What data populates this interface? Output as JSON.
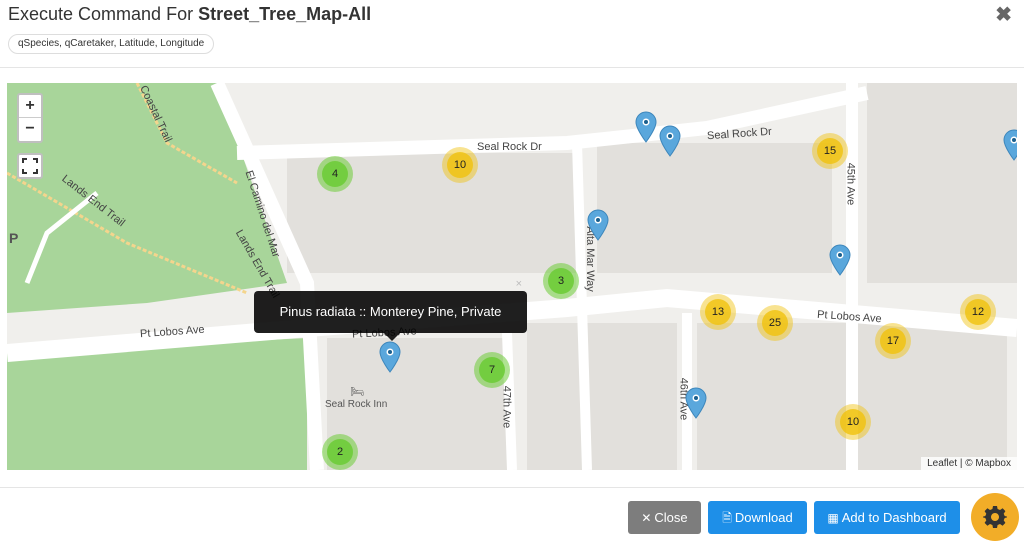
{
  "header": {
    "title_prefix": "Execute Command For ",
    "title_name": "Street_Tree_Map-All",
    "close_glyph": "✖",
    "fields_chip": "qSpecies, qCaretaker, Latitude, Longitude"
  },
  "map": {
    "zoom_in": "+",
    "zoom_out": "−",
    "streets": {
      "seal_rock_dr_1": "Seal Rock Dr",
      "seal_rock_dr_2": "Seal Rock Dr",
      "el_camino": "El Camino del Mar",
      "lands_end": "Lands End Trail",
      "coastal": "Coastal Trail",
      "alta_mar": "Alta Mar Way",
      "ave_45": "45th Ave",
      "ave_46": "46th Ave",
      "ave_47": "47th Ave",
      "pt_lobos_1": "Pt Lobos Ave",
      "pt_lobos_2": "Pt Lobos Ave",
      "pt_lobos_3": "Pt Lobos Ave"
    },
    "poi": "Seal Rock Inn",
    "p_marker": "P",
    "clusters": [
      {
        "count": "4",
        "color": "green"
      },
      {
        "count": "10",
        "color": "yellow"
      },
      {
        "count": "15",
        "color": "yellow"
      },
      {
        "count": "3",
        "color": "green"
      },
      {
        "count": "13",
        "color": "yellow"
      },
      {
        "count": "25",
        "color": "yellow"
      },
      {
        "count": "12",
        "color": "yellow"
      },
      {
        "count": "17",
        "color": "yellow"
      },
      {
        "count": "7",
        "color": "green"
      },
      {
        "count": "10",
        "color": "yellow"
      },
      {
        "count": "2",
        "color": "green"
      }
    ],
    "popup": {
      "text": "Pinus radiata :: Monterey Pine, Private",
      "close": "×"
    },
    "attribution": "Leaflet | © Mapbox"
  },
  "footer": {
    "close_label": "Close",
    "download_label": "Download",
    "dashboard_label": "Add to Dashboard"
  },
  "colors": {
    "primary": "#1e8fe8",
    "gray": "#7d7d7d",
    "gear": "#f2ad28",
    "cluster_green": "#6ecc39",
    "cluster_yellow": "#f0c20c",
    "pin": "#5aa7dc"
  }
}
